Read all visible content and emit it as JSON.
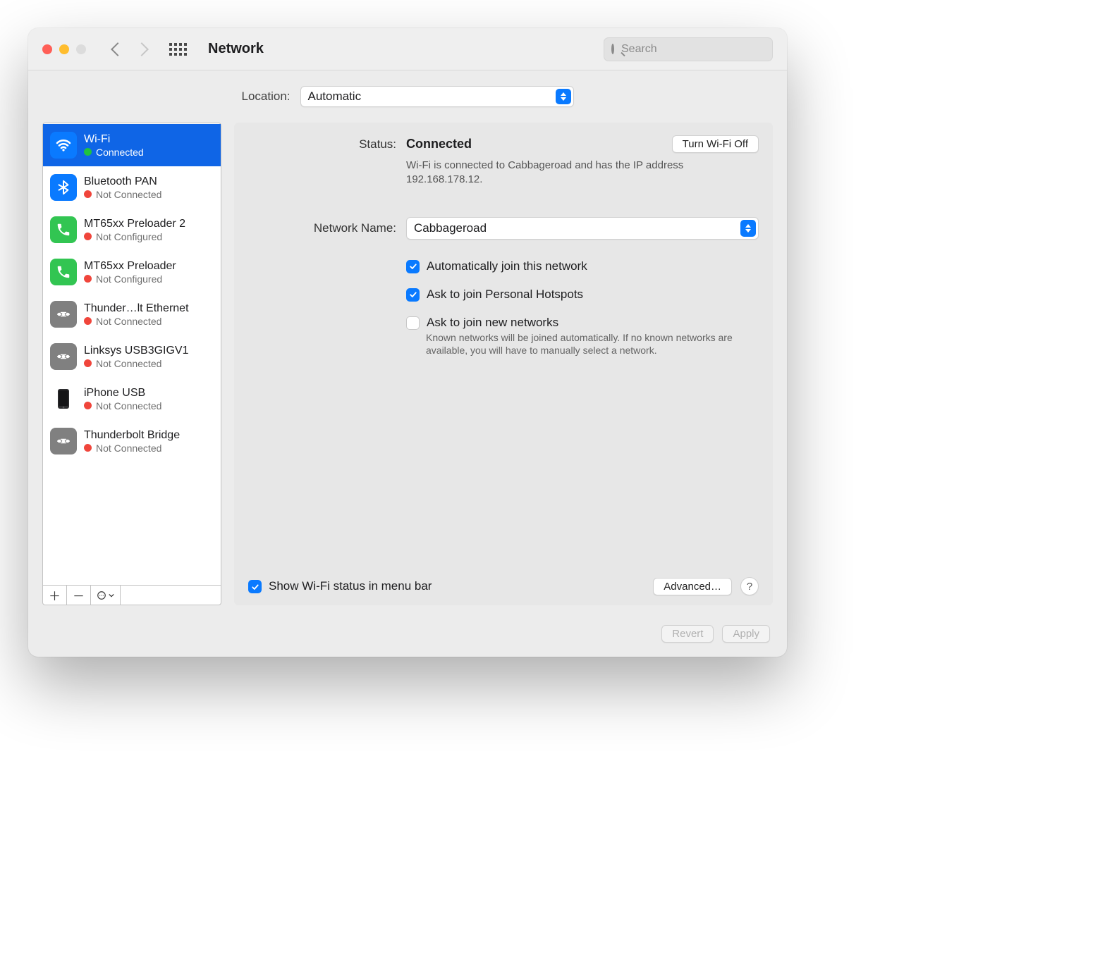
{
  "window": {
    "title": "Network"
  },
  "search": {
    "placeholder": "Search"
  },
  "location": {
    "label": "Location:",
    "value": "Automatic"
  },
  "services": [
    {
      "name": "Wi-Fi",
      "status": "Connected",
      "dot": "green",
      "icon": "wifi",
      "iconBg": "#0a7aff",
      "selected": true
    },
    {
      "name": "Bluetooth PAN",
      "status": "Not Connected",
      "dot": "red",
      "icon": "bluetooth",
      "iconBg": "#0a7aff"
    },
    {
      "name": "MT65xx Preloader 2",
      "status": "Not Configured",
      "dot": "red",
      "icon": "phone",
      "iconBg": "#32c552"
    },
    {
      "name": "MT65xx Preloader",
      "status": "Not Configured",
      "dot": "red",
      "icon": "phone",
      "iconBg": "#32c552"
    },
    {
      "name": "Thunder…lt Ethernet",
      "status": "Not Connected",
      "dot": "red",
      "icon": "ethernet",
      "iconBg": "#808080"
    },
    {
      "name": "Linksys USB3GIGV1",
      "status": "Not Connected",
      "dot": "red",
      "icon": "ethernet",
      "iconBg": "#808080"
    },
    {
      "name": "iPhone USB",
      "status": "Not Connected",
      "dot": "red",
      "icon": "iphone",
      "iconBg": "#2d2d2f"
    },
    {
      "name": "Thunderbolt Bridge",
      "status": "Not Connected",
      "dot": "red",
      "icon": "ethernet",
      "iconBg": "#808080"
    }
  ],
  "detail": {
    "statusLabel": "Status:",
    "statusValue": "Connected",
    "toggleBtn": "Turn Wi-Fi Off",
    "statusHint": "Wi-Fi is connected to Cabbageroad and has the IP address 192.168.178.12.",
    "networkNameLabel": "Network Name:",
    "networkName": "Cabbageroad",
    "autoJoinLabel": "Automatically join this network",
    "askHotspotLabel": "Ask to join Personal Hotspots",
    "askNewLabel": "Ask to join new networks",
    "askNewHint": "Known networks will be joined automatically. If no known networks are available, you will have to manually select a network.",
    "showStatusLabel": "Show Wi-Fi status in menu bar",
    "advancedBtn": "Advanced…",
    "checkboxes": {
      "autoJoin": true,
      "askHotspot": true,
      "askNew": false,
      "showStatus": true
    }
  },
  "footer": {
    "revert": "Revert",
    "apply": "Apply"
  }
}
